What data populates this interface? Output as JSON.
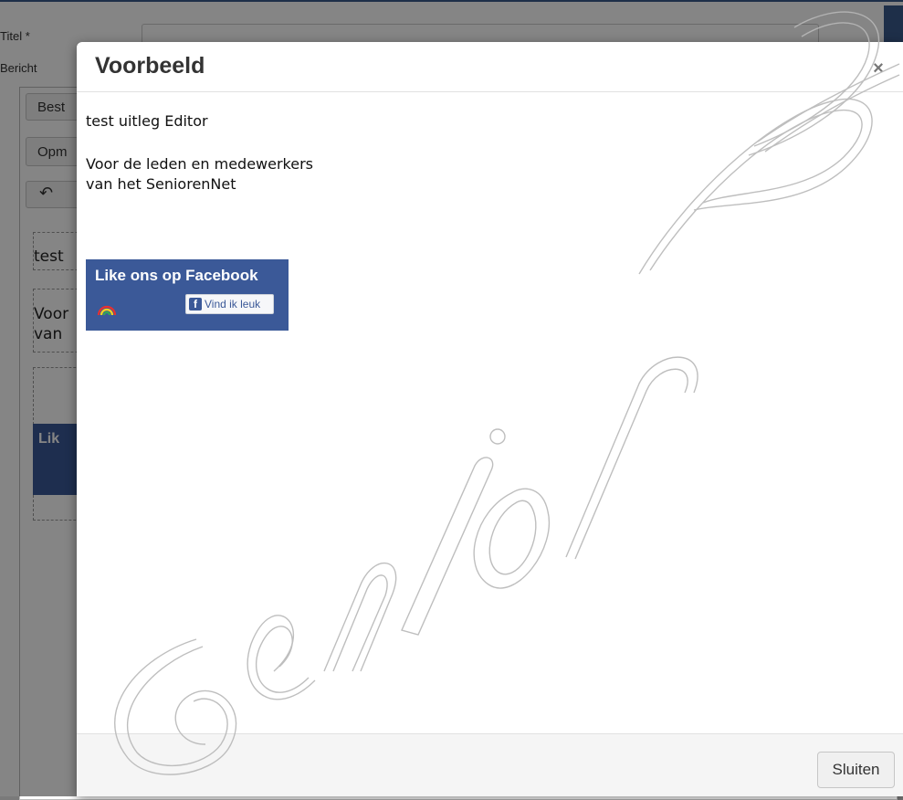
{
  "background": {
    "titel_label": "Titel *",
    "bericht_label": "Bericht",
    "tab_label": "Best",
    "opm_label": "Opm",
    "undo_icon": "undo-icon",
    "block1_text": "test",
    "block2_line1": "Voor",
    "block2_line2": "van",
    "fb_text": "Lik"
  },
  "modal": {
    "title": "Voorbeeld",
    "close_glyph": "×",
    "body": {
      "paragraph1": "test uitleg Editor",
      "paragraph2_line1": "Voor de leden en medewerkers",
      "paragraph2_line2": "van het SeniorenNet",
      "facebook_banner": {
        "title": "Like ons op Facebook",
        "like_button_label": "Vind ik leuk",
        "f_glyph": "f",
        "logo_icon": "seniorennet-logo-icon"
      }
    },
    "footer": {
      "close_button_label": "Sluiten"
    }
  },
  "watermark": {
    "text": "Seniorennet"
  },
  "colors": {
    "facebook_blue": "#3b5998",
    "overlay": "#000000"
  }
}
